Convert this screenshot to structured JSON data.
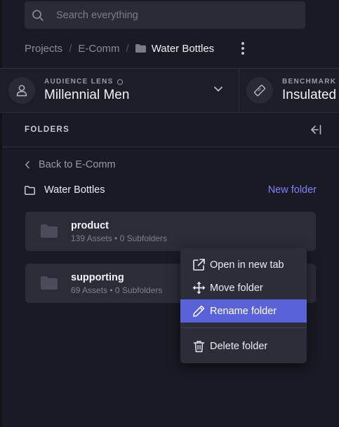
{
  "search": {
    "placeholder": "Search everything"
  },
  "breadcrumb": {
    "items": [
      "Projects",
      "E-Comm"
    ],
    "current": "Water Bottles"
  },
  "audience_lens": {
    "label": "AUDIENCE LENS",
    "value": "Millennial Men"
  },
  "benchmark": {
    "label": "BENCHMARK",
    "value": "Insulated"
  },
  "folders_panel": {
    "title": "FOLDERS",
    "back_label": "Back to E-Comm",
    "current_folder": "Water Bottles",
    "new_folder_label": "New folder"
  },
  "folders": [
    {
      "name": "product",
      "meta": "139 Assets • 0 Subfolders"
    },
    {
      "name": "supporting",
      "meta": "69 Assets • 0 Subfolders"
    }
  ],
  "context_menu": {
    "items": [
      {
        "label": "Open in new tab",
        "icon": "external-link-icon"
      },
      {
        "label": "Move folder",
        "icon": "move-icon"
      },
      {
        "label": "Rename folder",
        "icon": "pencil-icon",
        "highlighted": true
      },
      {
        "label": "Delete folder",
        "icon": "trash-icon"
      }
    ]
  },
  "colors": {
    "accent": "#7b83ff",
    "highlight": "#5a62d8",
    "background": "#1a1a24",
    "card": "#2c2c39"
  }
}
